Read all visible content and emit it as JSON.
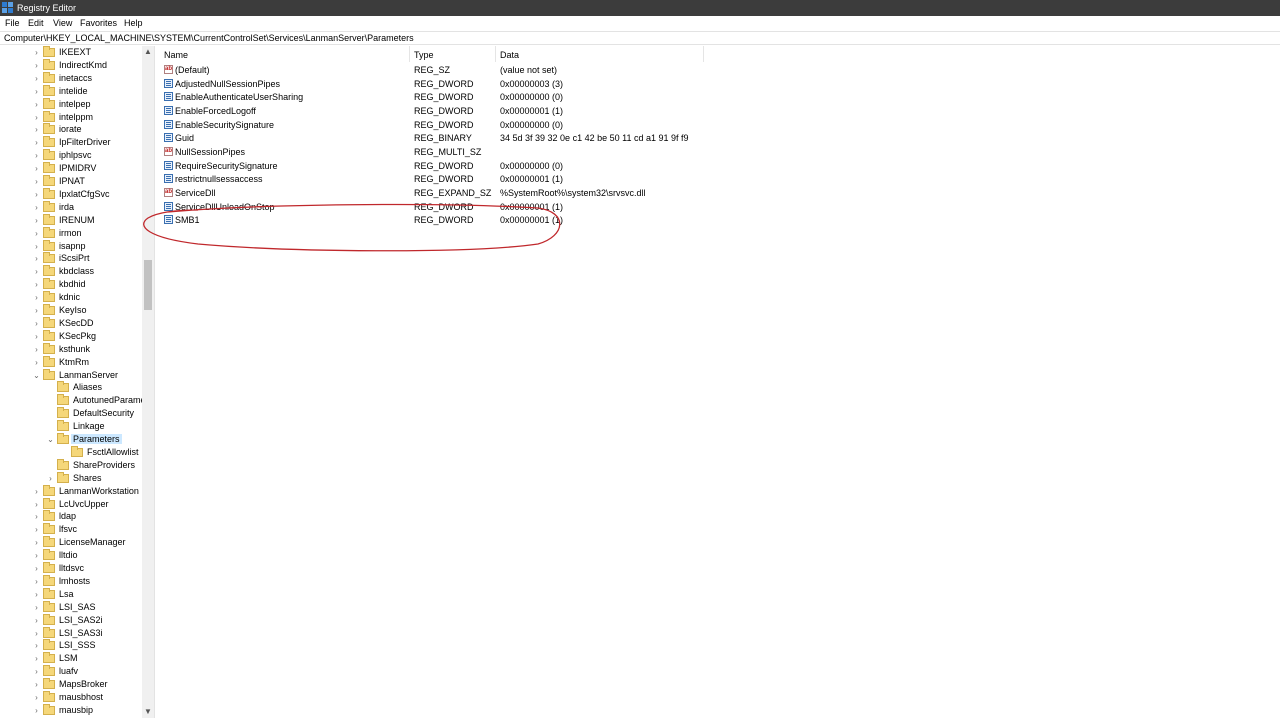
{
  "window": {
    "title": "Registry Editor"
  },
  "menu": [
    "File",
    "Edit",
    "View",
    "Favorites",
    "Help"
  ],
  "address": "Computer\\HKEY_LOCAL_MACHINE\\SYSTEM\\CurrentControlSet\\Services\\LanmanServer\\Parameters",
  "tree": [
    {
      "label": "IKEEXT",
      "level": 0,
      "state": "collapsed"
    },
    {
      "label": "IndirectKmd",
      "level": 0,
      "state": "collapsed"
    },
    {
      "label": "inetaccs",
      "level": 0,
      "state": "collapsed"
    },
    {
      "label": "intelide",
      "level": 0,
      "state": "collapsed"
    },
    {
      "label": "intelpep",
      "level": 0,
      "state": "collapsed"
    },
    {
      "label": "intelppm",
      "level": 0,
      "state": "collapsed"
    },
    {
      "label": "iorate",
      "level": 0,
      "state": "collapsed"
    },
    {
      "label": "IpFilterDriver",
      "level": 0,
      "state": "collapsed"
    },
    {
      "label": "iphlpsvc",
      "level": 0,
      "state": "collapsed"
    },
    {
      "label": "IPMIDRV",
      "level": 0,
      "state": "collapsed"
    },
    {
      "label": "IPNAT",
      "level": 0,
      "state": "collapsed"
    },
    {
      "label": "IpxlatCfgSvc",
      "level": 0,
      "state": "collapsed"
    },
    {
      "label": "irda",
      "level": 0,
      "state": "collapsed"
    },
    {
      "label": "IRENUM",
      "level": 0,
      "state": "collapsed"
    },
    {
      "label": "irmon",
      "level": 0,
      "state": "collapsed"
    },
    {
      "label": "isapnp",
      "level": 0,
      "state": "collapsed"
    },
    {
      "label": "iScsiPrt",
      "level": 0,
      "state": "collapsed"
    },
    {
      "label": "kbdclass",
      "level": 0,
      "state": "collapsed"
    },
    {
      "label": "kbdhid",
      "level": 0,
      "state": "collapsed"
    },
    {
      "label": "kdnic",
      "level": 0,
      "state": "collapsed"
    },
    {
      "label": "KeyIso",
      "level": 0,
      "state": "collapsed"
    },
    {
      "label": "KSecDD",
      "level": 0,
      "state": "collapsed"
    },
    {
      "label": "KSecPkg",
      "level": 0,
      "state": "collapsed"
    },
    {
      "label": "ksthunk",
      "level": 0,
      "state": "collapsed"
    },
    {
      "label": "KtmRm",
      "level": 0,
      "state": "collapsed"
    },
    {
      "label": "LanmanServer",
      "level": 0,
      "state": "expanded"
    },
    {
      "label": "Aliases",
      "level": 1,
      "state": "none"
    },
    {
      "label": "AutotunedParameters",
      "level": 1,
      "state": "none"
    },
    {
      "label": "DefaultSecurity",
      "level": 1,
      "state": "none"
    },
    {
      "label": "Linkage",
      "level": 1,
      "state": "none"
    },
    {
      "label": "Parameters",
      "level": 1,
      "state": "expanded",
      "selected": true
    },
    {
      "label": "FsctlAllowlist",
      "level": 2,
      "state": "none"
    },
    {
      "label": "ShareProviders",
      "level": 1,
      "state": "none"
    },
    {
      "label": "Shares",
      "level": 1,
      "state": "collapsed"
    },
    {
      "label": "LanmanWorkstation",
      "level": 0,
      "state": "collapsed"
    },
    {
      "label": "LcUvcUpper",
      "level": 0,
      "state": "collapsed"
    },
    {
      "label": "ldap",
      "level": 0,
      "state": "collapsed"
    },
    {
      "label": "lfsvc",
      "level": 0,
      "state": "collapsed"
    },
    {
      "label": "LicenseManager",
      "level": 0,
      "state": "collapsed"
    },
    {
      "label": "lltdio",
      "level": 0,
      "state": "collapsed"
    },
    {
      "label": "lltdsvc",
      "level": 0,
      "state": "collapsed"
    },
    {
      "label": "lmhosts",
      "level": 0,
      "state": "collapsed"
    },
    {
      "label": "Lsa",
      "level": 0,
      "state": "collapsed"
    },
    {
      "label": "LSI_SAS",
      "level": 0,
      "state": "collapsed"
    },
    {
      "label": "LSI_SAS2i",
      "level": 0,
      "state": "collapsed"
    },
    {
      "label": "LSI_SAS3i",
      "level": 0,
      "state": "collapsed"
    },
    {
      "label": "LSI_SSS",
      "level": 0,
      "state": "collapsed"
    },
    {
      "label": "LSM",
      "level": 0,
      "state": "collapsed"
    },
    {
      "label": "luafv",
      "level": 0,
      "state": "collapsed"
    },
    {
      "label": "MapsBroker",
      "level": 0,
      "state": "collapsed"
    },
    {
      "label": "mausbhost",
      "level": 0,
      "state": "collapsed"
    },
    {
      "label": "mausbip",
      "level": 0,
      "state": "collapsed"
    }
  ],
  "columns": {
    "name": "Name",
    "type": "Type",
    "data": "Data"
  },
  "values": [
    {
      "name": "(Default)",
      "type": "REG_SZ",
      "data": "(value not set)",
      "icon": "string-value-icon"
    },
    {
      "name": "AdjustedNullSessionPipes",
      "type": "REG_DWORD",
      "data": "0x00000003 (3)",
      "icon": "binary-value-icon"
    },
    {
      "name": "EnableAuthenticateUserSharing",
      "type": "REG_DWORD",
      "data": "0x00000000 (0)",
      "icon": "binary-value-icon"
    },
    {
      "name": "EnableForcedLogoff",
      "type": "REG_DWORD",
      "data": "0x00000001 (1)",
      "icon": "binary-value-icon"
    },
    {
      "name": "EnableSecuritySignature",
      "type": "REG_DWORD",
      "data": "0x00000000 (0)",
      "icon": "binary-value-icon"
    },
    {
      "name": "Guid",
      "type": "REG_BINARY",
      "data": "34 5d 3f 39 32 0e c1 42 be 50 11 cd a1 91 9f f9",
      "icon": "binary-value-icon"
    },
    {
      "name": "NullSessionPipes",
      "type": "REG_MULTI_SZ",
      "data": "",
      "icon": "string-value-icon"
    },
    {
      "name": "RequireSecuritySignature",
      "type": "REG_DWORD",
      "data": "0x00000000 (0)",
      "icon": "binary-value-icon"
    },
    {
      "name": "restrictnullsessaccess",
      "type": "REG_DWORD",
      "data": "0x00000001 (1)",
      "icon": "binary-value-icon"
    },
    {
      "name": "ServiceDll",
      "type": "REG_EXPAND_SZ",
      "data": "%SystemRoot%\\system32\\srvsvc.dll",
      "icon": "string-value-icon"
    },
    {
      "name": "ServiceDllUnloadOnStop",
      "type": "REG_DWORD",
      "data": "0x00000001 (1)",
      "icon": "binary-value-icon"
    },
    {
      "name": "SMB1",
      "type": "REG_DWORD",
      "data": "0x00000001 (1)",
      "icon": "binary-value-icon"
    }
  ],
  "colors": {
    "annotation": "#c0282c",
    "selection": "#cce8ff",
    "folder": "#f5d77a",
    "titlebar": "#3c3c3c"
  }
}
